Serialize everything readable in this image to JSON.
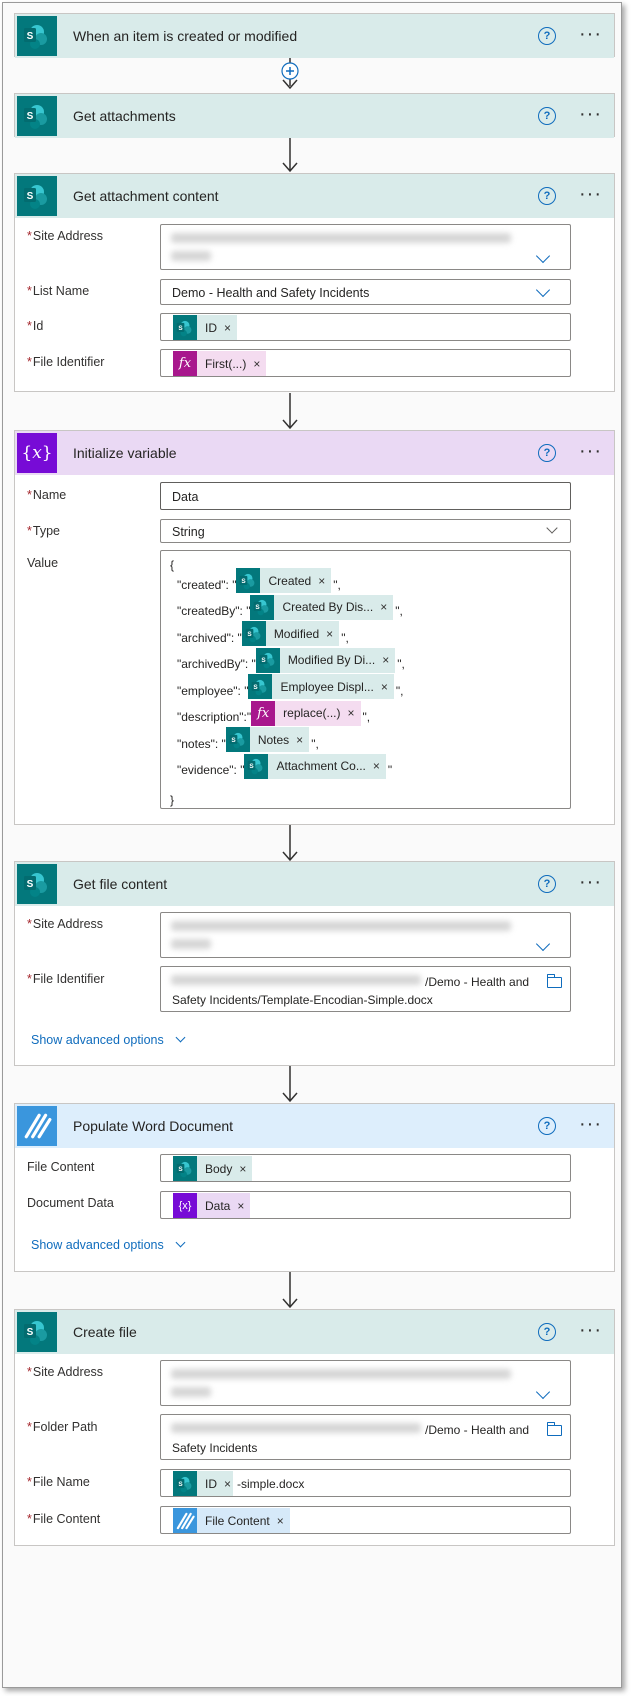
{
  "colors": {
    "sharepoint": "#03787c",
    "sharepoint_header": "#d9ebea",
    "variable": "#770bd6",
    "variable_header": "#ead9f4",
    "encodian": "#3a96dd",
    "encodian_header": "#ddeefc",
    "link": "#0f6cbd",
    "required": "#a4262c"
  },
  "help_glyph": "?",
  "more_glyph": "···",
  "remove_glyph": "×",
  "required_mark": "*",
  "card1": {
    "title": "When an item is created or modified"
  },
  "card2": {
    "title": "Get attachments"
  },
  "card3": {
    "title": "Get attachment content",
    "site_label": "Site Address",
    "list_label": "List Name",
    "list_value": "Demo - Health and Safety Incidents",
    "id_label": "Id",
    "id_token": "ID",
    "file_label": "File Identifier",
    "file_token": "First(...)"
  },
  "card4": {
    "title": "Initialize variable",
    "name_label": "Name",
    "name_value": "Data",
    "type_label": "Type",
    "type_value": "String",
    "value_label": "Value",
    "open_brace": "{",
    "close_brace": "}",
    "lines": [
      {
        "key": "\"created\": \"",
        "token": "Created",
        "suffix": "\","
      },
      {
        "key": "\"createdBy\": \"",
        "token": "Created By Dis...",
        "suffix": "\","
      },
      {
        "key": "\"archived\": \"",
        "token": "Modified",
        "suffix": "\","
      },
      {
        "key": "\"archivedBy\": \"",
        "token": "Modified By Di...",
        "suffix": "\","
      },
      {
        "key": "\"employee\": \"",
        "token": "Employee Displ...",
        "suffix": "\","
      },
      {
        "key": "\"description\":\"",
        "token": "replace(...)",
        "suffix": "\","
      },
      {
        "key": "\"notes\": \"",
        "token": "Notes",
        "suffix": "\","
      },
      {
        "key": "\"evidence\": \"",
        "token": "Attachment Co...",
        "suffix": "\""
      }
    ]
  },
  "card5": {
    "title": "Get file content",
    "site_label": "Site Address",
    "file_label": "File Identifier",
    "file_value_1": "/Demo - Health and",
    "file_value_2": "Safety Incidents/Template-Encodian-Simple.docx",
    "advanced": "Show advanced options"
  },
  "card6": {
    "title": "Populate Word Document",
    "content_label": "File Content",
    "content_token": "Body",
    "data_label": "Document Data",
    "data_token": "Data",
    "advanced": "Show advanced options"
  },
  "card7": {
    "title": "Create file",
    "site_label": "Site Address",
    "folder_label": "Folder Path",
    "folder_value_1": "/Demo - Health and",
    "folder_value_2": "Safety Incidents",
    "name_label": "File Name",
    "name_token": "ID",
    "name_suffix": "-simple.docx",
    "content_label": "File Content",
    "content_token": "File Content"
  }
}
